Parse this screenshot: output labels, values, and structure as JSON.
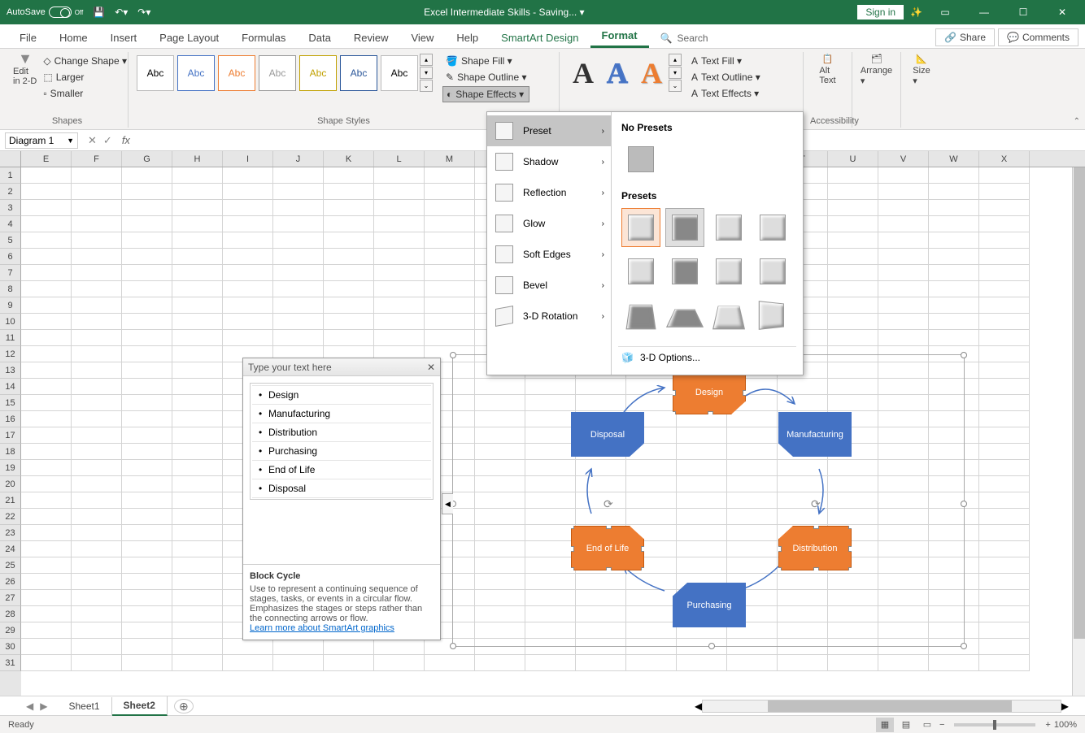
{
  "titlebar": {
    "autosave": "AutoSave",
    "autosave_state": "Off",
    "doc_title": "Excel Intermediate Skills  -  Saving... ▾",
    "signin": "Sign in"
  },
  "tabs": [
    "File",
    "Home",
    "Insert",
    "Page Layout",
    "Formulas",
    "Data",
    "Review",
    "View",
    "Help",
    "SmartArt Design",
    "Format"
  ],
  "tabs_active": "Format",
  "search_placeholder": "Search",
  "share": "Share",
  "comments": "Comments",
  "ribbon": {
    "shapes": {
      "edit2d": "Edit\nin 2-D",
      "change_shape": "Change Shape ▾",
      "larger": "Larger",
      "smaller": "Smaller",
      "group": "Shapes"
    },
    "styles": {
      "label": "Abc",
      "group": "Shape Styles",
      "fill": "Shape Fill ▾",
      "outline": "Shape Outline ▾",
      "effects": "Shape Effects ▾"
    },
    "wordart": {
      "text_fill": "Text Fill ▾",
      "text_outline": "Text Outline ▾",
      "text_effects": "Text Effects ▾"
    },
    "alt_text": "Alt\nText",
    "accessibility": "Accessibility",
    "arrange": "Arrange\n▾",
    "size": "Size\n▾"
  },
  "effects_menu": {
    "items": [
      "Preset",
      "Shadow",
      "Reflection",
      "Glow",
      "Soft Edges",
      "Bevel",
      "3-D Rotation"
    ],
    "active": "Preset",
    "no_presets": "No Presets",
    "presets": "Presets",
    "options3d": "3-D Options..."
  },
  "namebox": "Diagram 1",
  "columns": [
    "E",
    "F",
    "G",
    "H",
    "I",
    "J",
    "K",
    "L",
    "M",
    "",
    "",
    "",
    "",
    "",
    "",
    "T",
    "U",
    "V",
    "W",
    "X"
  ],
  "rows": [
    1,
    2,
    3,
    4,
    5,
    6,
    7,
    8,
    9,
    10,
    11,
    12,
    13,
    14,
    15,
    16,
    17,
    18,
    19,
    20,
    21,
    22,
    23,
    24,
    25,
    26,
    27,
    28,
    29,
    30,
    31
  ],
  "text_pane": {
    "title": "Type your text here",
    "items": [
      "Design",
      "Manufacturing",
      "Distribution",
      "Purchasing",
      "End of Life",
      "Disposal"
    ],
    "desc_title": "Block Cycle",
    "desc": "Use to represent a continuing sequence of stages, tasks, or events in a circular flow. Emphasizes the stages or steps rather than the connecting arrows or flow.",
    "link": "Learn more about SmartArt graphics"
  },
  "smartart": {
    "nodes": {
      "design": "Design",
      "manufacturing": "Manufacturing",
      "distribution": "Distribution",
      "purchasing": "Purchasing",
      "endoflife": "End of Life",
      "disposal": "Disposal"
    }
  },
  "sheets": {
    "names": [
      "Sheet1",
      "Sheet2"
    ],
    "active": "Sheet2"
  },
  "status": {
    "ready": "Ready",
    "zoom": "100%"
  }
}
